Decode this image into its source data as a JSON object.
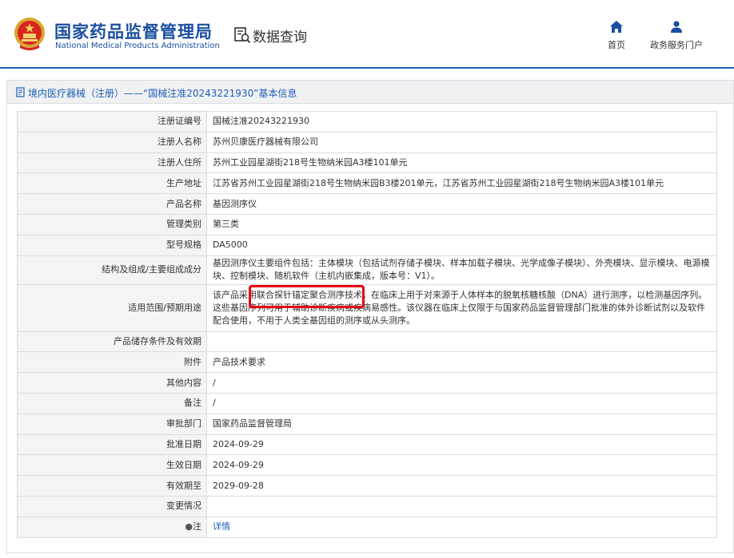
{
  "header": {
    "brand_cn": "国家药品监督管理局",
    "brand_en": "National Medical Products Administration",
    "query_label": "数据查询",
    "nav": {
      "home_label": "首页",
      "portal_label": "政务服务门户"
    }
  },
  "breadcrumb": {
    "text": "境内医疗器械（注册）——“国械注准20243221930”基本信息"
  },
  "rows": [
    {
      "label": "注册证编号",
      "value": "国械注准20243221930"
    },
    {
      "label": "注册人名称",
      "value": "苏州贝康医疗器械有限公司"
    },
    {
      "label": "注册人住所",
      "value": "苏州工业园星湖街218号生物纳米园A3楼101单元"
    },
    {
      "label": "生产地址",
      "value": "江苏省苏州工业园星湖街218号生物纳米园B3楼201单元，江苏省苏州工业园星湖街218号生物纳米园A3楼101单元"
    },
    {
      "label": "产品名称",
      "value": "基因测序仪"
    },
    {
      "label": "管理类别",
      "value": "第三类"
    },
    {
      "label": "型号规格",
      "value": "DA5000"
    },
    {
      "label": "结构及组成/主要组成成分",
      "value": "基因测序仪主要组件包括：主体模块（包括试剂存储子模块、样本加载子模块、光学成像子模块）、外壳模块、显示模块、电源模块、控制模块、随机软件（主机内嵌集成，版本号：V1）。"
    },
    {
      "label": "适用范围/预期用途",
      "value": "该产品采用联合探针锚定聚合测序技术，在临床上用于对来源于人体样本的脱氧核糖核酸（DNA）进行测序，以检测基因序列。这些基因序列可用于辅助诊断疾病或疾病易感性。该仪器在临床上仅限于与国家药品监督管理部门批准的体外诊断试剂以及软件配合使用，不用于人类全基因组的测序或从头测序。"
    },
    {
      "label": "产品储存条件及有效期",
      "value": ""
    },
    {
      "label": "附件",
      "value": "产品技术要求"
    },
    {
      "label": "其他内容",
      "value": "/"
    },
    {
      "label": "备注",
      "value": "/"
    },
    {
      "label": "审批部门",
      "value": "国家药品监督管理局"
    },
    {
      "label": "批准日期",
      "value": "2024-09-29"
    },
    {
      "label": "生效日期",
      "value": "2024-09-29"
    },
    {
      "label": "有效期至",
      "value": "2029-09-28"
    },
    {
      "label": "变更情况",
      "value": ""
    },
    {
      "label": "注",
      "value": "详情"
    }
  ],
  "colors": {
    "brand_blue": "#1a4fa0",
    "link_blue": "#1f5fb8",
    "highlight_red": "#e60012"
  }
}
